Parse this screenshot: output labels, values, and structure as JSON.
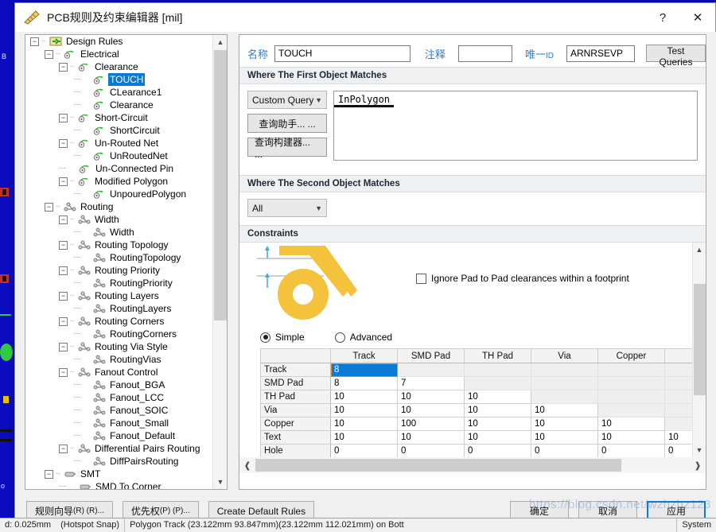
{
  "window": {
    "title": "PCB规则及约束编辑器 [mil]",
    "icon": "ruler-icon",
    "help_label": "?",
    "close_label": "✕"
  },
  "tree": {
    "nodes": [
      {
        "label": "Design Rules",
        "depth": 0,
        "expander": "-",
        "icon": "design-rules-icon",
        "selected": false
      },
      {
        "label": "Electrical",
        "depth": 1,
        "expander": "-",
        "icon": "electrical-icon",
        "selected": false
      },
      {
        "label": "Clearance",
        "depth": 2,
        "expander": "-",
        "icon": "electrical-icon",
        "selected": false
      },
      {
        "label": "TOUCH",
        "depth": 3,
        "expander": "",
        "icon": "electrical-icon",
        "selected": true
      },
      {
        "label": "CLearance1",
        "depth": 3,
        "expander": "",
        "icon": "electrical-icon",
        "selected": false
      },
      {
        "label": "Clearance",
        "depth": 3,
        "expander": "",
        "icon": "electrical-icon",
        "selected": false
      },
      {
        "label": "Short-Circuit",
        "depth": 2,
        "expander": "-",
        "icon": "electrical-icon",
        "selected": false
      },
      {
        "label": "ShortCircuit",
        "depth": 3,
        "expander": "",
        "icon": "electrical-icon",
        "selected": false
      },
      {
        "label": "Un-Routed Net",
        "depth": 2,
        "expander": "-",
        "icon": "electrical-icon",
        "selected": false
      },
      {
        "label": "UnRoutedNet",
        "depth": 3,
        "expander": "",
        "icon": "electrical-icon",
        "selected": false
      },
      {
        "label": "Un-Connected Pin",
        "depth": 2,
        "expander": "",
        "icon": "electrical-icon",
        "selected": false
      },
      {
        "label": "Modified Polygon",
        "depth": 2,
        "expander": "-",
        "icon": "electrical-icon",
        "selected": false
      },
      {
        "label": "UnpouredPolygon",
        "depth": 3,
        "expander": "",
        "icon": "electrical-icon",
        "selected": false
      },
      {
        "label": "Routing",
        "depth": 1,
        "expander": "-",
        "icon": "routing-icon",
        "selected": false
      },
      {
        "label": "Width",
        "depth": 2,
        "expander": "-",
        "icon": "routing-icon",
        "selected": false
      },
      {
        "label": "Width",
        "depth": 3,
        "expander": "",
        "icon": "routing-icon",
        "selected": false
      },
      {
        "label": "Routing Topology",
        "depth": 2,
        "expander": "-",
        "icon": "routing-icon",
        "selected": false
      },
      {
        "label": "RoutingTopology",
        "depth": 3,
        "expander": "",
        "icon": "routing-icon",
        "selected": false
      },
      {
        "label": "Routing Priority",
        "depth": 2,
        "expander": "-",
        "icon": "routing-icon",
        "selected": false
      },
      {
        "label": "RoutingPriority",
        "depth": 3,
        "expander": "",
        "icon": "routing-icon",
        "selected": false
      },
      {
        "label": "Routing Layers",
        "depth": 2,
        "expander": "-",
        "icon": "routing-icon",
        "selected": false
      },
      {
        "label": "RoutingLayers",
        "depth": 3,
        "expander": "",
        "icon": "routing-icon",
        "selected": false
      },
      {
        "label": "Routing Corners",
        "depth": 2,
        "expander": "-",
        "icon": "routing-icon",
        "selected": false
      },
      {
        "label": "RoutingCorners",
        "depth": 3,
        "expander": "",
        "icon": "routing-icon",
        "selected": false
      },
      {
        "label": "Routing Via Style",
        "depth": 2,
        "expander": "-",
        "icon": "routing-icon",
        "selected": false
      },
      {
        "label": "RoutingVias",
        "depth": 3,
        "expander": "",
        "icon": "routing-icon",
        "selected": false
      },
      {
        "label": "Fanout Control",
        "depth": 2,
        "expander": "-",
        "icon": "routing-icon",
        "selected": false
      },
      {
        "label": "Fanout_BGA",
        "depth": 3,
        "expander": "",
        "icon": "routing-icon",
        "selected": false
      },
      {
        "label": "Fanout_LCC",
        "depth": 3,
        "expander": "",
        "icon": "routing-icon",
        "selected": false
      },
      {
        "label": "Fanout_SOIC",
        "depth": 3,
        "expander": "",
        "icon": "routing-icon",
        "selected": false
      },
      {
        "label": "Fanout_Small",
        "depth": 3,
        "expander": "",
        "icon": "routing-icon",
        "selected": false
      },
      {
        "label": "Fanout_Default",
        "depth": 3,
        "expander": "",
        "icon": "routing-icon",
        "selected": false
      },
      {
        "label": "Differential Pairs Routing",
        "depth": 2,
        "expander": "-",
        "icon": "routing-icon",
        "selected": false
      },
      {
        "label": "DiffPairsRouting",
        "depth": 3,
        "expander": "",
        "icon": "routing-icon",
        "selected": false
      },
      {
        "label": "SMT",
        "depth": 1,
        "expander": "-",
        "icon": "smt-icon",
        "selected": false
      },
      {
        "label": "SMD To Corner",
        "depth": 2,
        "expander": "",
        "icon": "smt-icon",
        "selected": false
      }
    ]
  },
  "form": {
    "name_label": "名称",
    "name_value": "TOUCH",
    "comment_label": "注释",
    "comment_value": "",
    "unique_id_label": "唯一ID",
    "unique_id_value": "ARNRSEVP",
    "test_queries_label": "Test Queries"
  },
  "first_object": {
    "section_title": "Where The First Object Matches",
    "scope_value": "Custom Query",
    "query_helper_label": "查询助手... ...",
    "query_builder_label": "查询构建器... ...",
    "query_text": "InPolygon"
  },
  "second_object": {
    "section_title": "Where The Second Object Matches",
    "scope_value": "All"
  },
  "constraints": {
    "section_title": "Constraints",
    "ignore_pad_label": "Ignore Pad to Pad clearances within a footprint",
    "ignore_pad_checked": false,
    "simple_label": "Simple",
    "advanced_label": "Advanced",
    "mode": "Simple",
    "matrix": {
      "columns": [
        "Track",
        "SMD Pad",
        "TH Pad",
        "Via",
        "Copper",
        ""
      ],
      "rows": [
        {
          "header": "Track",
          "cells": [
            "8",
            "",
            "",
            "",
            "",
            ""
          ],
          "selected_index": 0
        },
        {
          "header": "SMD Pad",
          "cells": [
            "8",
            "7",
            "",
            "",
            "",
            ""
          ],
          "selected_index": -1
        },
        {
          "header": "TH Pad",
          "cells": [
            "10",
            "10",
            "10",
            "",
            "",
            ""
          ],
          "selected_index": -1
        },
        {
          "header": "Via",
          "cells": [
            "10",
            "10",
            "10",
            "10",
            "",
            ""
          ],
          "selected_index": -1
        },
        {
          "header": "Copper",
          "cells": [
            "10",
            "100",
            "10",
            "10",
            "10",
            ""
          ],
          "selected_index": -1
        },
        {
          "header": "Text",
          "cells": [
            "10",
            "10",
            "10",
            "10",
            "10",
            "10"
          ],
          "selected_index": -1
        },
        {
          "header": "Hole",
          "cells": [
            "0",
            "0",
            "0",
            "0",
            "0",
            "0"
          ],
          "selected_index": -1
        }
      ]
    }
  },
  "footer": {
    "left_buttons": [
      {
        "label": "规则向导",
        "mnemonic": "(R) (R)..."
      },
      {
        "label": "优先权",
        "mnemonic": "(P) (P)..."
      },
      {
        "label": "Create Default Rules",
        "mnemonic": ""
      }
    ],
    "right_buttons": [
      {
        "label": "确定",
        "primary": false
      },
      {
        "label": "取消",
        "primary": false
      },
      {
        "label": "应用",
        "primary": true
      }
    ]
  },
  "statusbar": {
    "snap": "d: 0.025mm",
    "hotspot": "(Hotspot Snap)",
    "message": "Polygon Track (23.122mm 93.847mm)(23.122mm 112.021mm) on Bott",
    "system": "System"
  },
  "watermark": "https://blog.csdn.net/wzhzhz123"
}
